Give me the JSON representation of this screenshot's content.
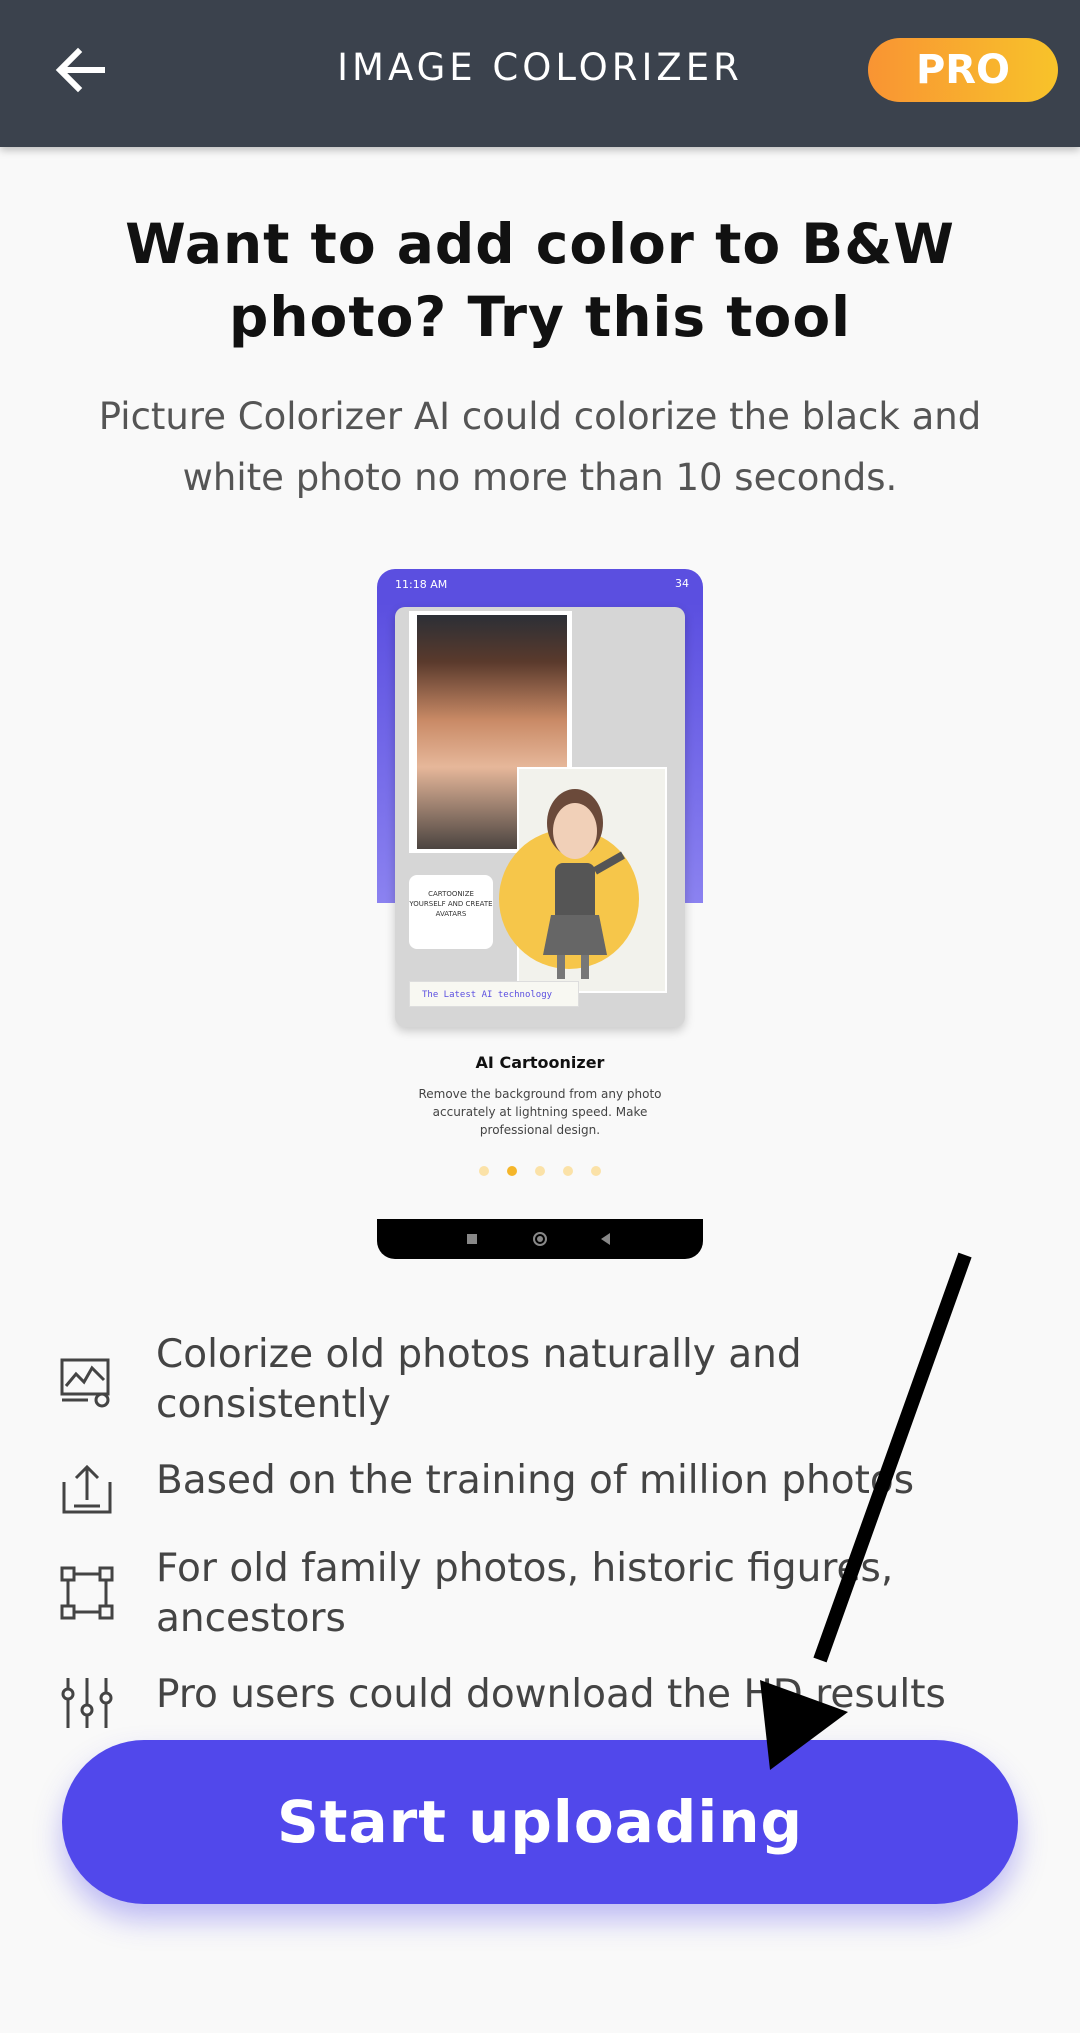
{
  "header": {
    "title": "IMAGE COLORIZER",
    "pro_label": "PRO",
    "back_icon": "arrow-left-icon"
  },
  "intro": {
    "headline": "Want to add color to B&W photo? Try this tool",
    "subtext": "Picture Colorizer AI could colorize the black and white photo no more than 10 seconds."
  },
  "preview": {
    "time": "11:18 AM",
    "status": "34",
    "label_card": "CARTOONIZE YOURSELF AND CREATE AVATARS",
    "tag": "The Latest AI technology",
    "feature_title": "AI Cartoonizer",
    "feature_desc": "Remove the background from any photo accurately at lightning speed. Make professional design.",
    "dot_count": 5,
    "active_dot": 2
  },
  "features": [
    {
      "icon": "image-settings-icon",
      "text": "Colorize old photos naturally and consistently"
    },
    {
      "icon": "upload-icon",
      "text": "Based on the training of million photos"
    },
    {
      "icon": "crop-frame-icon",
      "text": "For old family photos, historic figures, ancestors"
    },
    {
      "icon": "sliders-icon",
      "text": "Pro users could download the HD results"
    }
  ],
  "cta": {
    "label": "Start uploading"
  },
  "colors": {
    "header_bg": "#3b424d",
    "accent": "#5148eb",
    "pro_gradient_start": "#f99433",
    "pro_gradient_end": "#f8c32a"
  }
}
